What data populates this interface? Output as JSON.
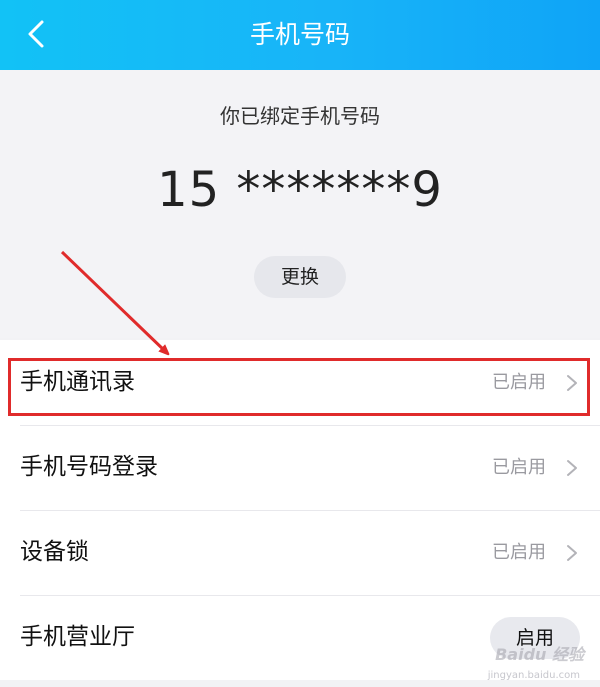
{
  "header": {
    "title": "手机号码",
    "back_icon": "chevron-left-icon"
  },
  "bound": {
    "label": "你已绑定手机号码",
    "phone_masked": "15 *******9",
    "change_button": "更换"
  },
  "settings": [
    {
      "label": "手机通讯录",
      "status": "已启用",
      "icon": "chevron-right-icon"
    },
    {
      "label": "手机号码登录",
      "status": "已启用",
      "icon": "chevron-right-icon"
    },
    {
      "label": "设备锁",
      "status": "已启用",
      "icon": "chevron-right-icon"
    },
    {
      "label": "手机营业厅",
      "action": "启用"
    }
  ],
  "watermark": {
    "brand": "Baidu 经验",
    "url": "jingyan.baidu.com"
  },
  "colors": {
    "header_gradient_start": "#12c2f6",
    "header_gradient_end": "#0fa4f7",
    "annotation_red": "#e02b2b"
  }
}
